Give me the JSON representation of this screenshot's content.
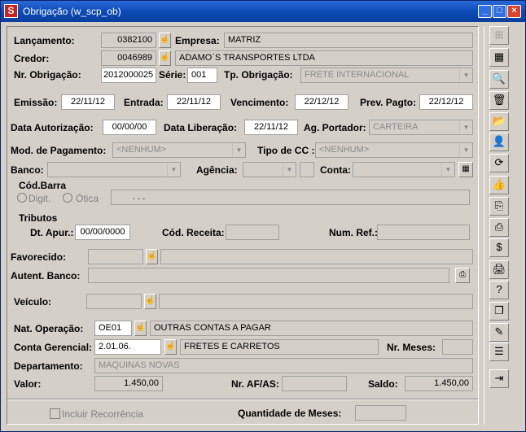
{
  "window": {
    "title": "Obrigação (w_scp_ob)",
    "app_icon": "S",
    "minimize": "_",
    "maximize": "□",
    "close": "×"
  },
  "lancamento": {
    "label": "Lançamento:",
    "value": "0382100"
  },
  "empresa": {
    "label": "Empresa:",
    "value": "MATRIZ"
  },
  "credor": {
    "label": "Credor:",
    "value": "0046989",
    "name": "ADAMO´S TRANSPORTES LTDA"
  },
  "nr_obrigacao": {
    "label": "Nr. Obrigação:",
    "value": "2012000025"
  },
  "serie": {
    "label": "Série:",
    "value": "001"
  },
  "tp_obrigacao": {
    "label": "Tp. Obrigação:",
    "value": "FRETE INTERNACIONAL"
  },
  "emissao": {
    "label": "Emissão:",
    "value": "22/11/12"
  },
  "entrada": {
    "label": "Entrada:",
    "value": "22/11/12"
  },
  "vencimento": {
    "label": "Vencimento:",
    "value": "22/12/12"
  },
  "prev_pagto": {
    "label": "Prev. Pagto:",
    "value": "22/12/12"
  },
  "data_autorizacao": {
    "label": "Data Autorização:",
    "value": "00/00/00"
  },
  "data_liberacao": {
    "label": "Data Liberação:",
    "value": "22/11/12"
  },
  "ag_portador": {
    "label": "Ag. Portador:",
    "value": "CARTEIRA"
  },
  "mod_pagamento": {
    "label": "Mod. de Pagamento:",
    "value": "<NENHUM>"
  },
  "tipo_cc": {
    "label": "Tipo de CC :",
    "value": "<NENHUM>"
  },
  "banco": {
    "label": "Banco:",
    "value": ""
  },
  "agencia": {
    "label": "Agência:",
    "value": ""
  },
  "conta": {
    "label": "Conta:",
    "value": ""
  },
  "cod_barra": {
    "label": "Cód.Barra",
    "digit": "Digit.",
    "otica": "Ótica",
    "value": ".            .            ."
  },
  "tributos": {
    "label": "Tributos",
    "dt_apur_label": "Dt. Apur.:",
    "dt_apur": "00/00/0000",
    "cod_receita_label": "Cód. Receita:",
    "cod_receita": "",
    "num_ref_label": "Num. Ref.:",
    "num_ref": ""
  },
  "favorecido": {
    "label": "Favorecido:",
    "code": "",
    "name": ""
  },
  "autent_banco": {
    "label": "Autent. Banco:",
    "value": ""
  },
  "veiculo": {
    "label": "Veículo:",
    "code": "",
    "name": ""
  },
  "nat_operacao": {
    "label": "Nat. Operação:",
    "code": "OE01",
    "name": "OUTRAS CONTAS A PAGAR"
  },
  "conta_gerencial": {
    "label": "Conta Gerencial:",
    "code": "2.01.06.",
    "name": "FRETES E CARRETOS"
  },
  "nr_meses": {
    "label": "Nr. Meses:",
    "value": ""
  },
  "departamento": {
    "label": "Departamento:",
    "value": "MAQUINAS NOVAS"
  },
  "valor": {
    "label": "Valor:",
    "value": "1.450,00"
  },
  "nr_af_as": {
    "label": "Nr. AF/AS:",
    "value": ""
  },
  "saldo": {
    "label": "Saldo:",
    "value": "1.450,00"
  },
  "incluir_recorrencia": {
    "label": "Incluir Recorrência"
  },
  "quantidade_meses": {
    "label": "Quantidade de Meses:",
    "value": ""
  },
  "lookup_glyph": "☝",
  "dropdown_glyph": "▼",
  "toolbar": [
    {
      "name": "tree-structure-icon",
      "glyph": "⊞",
      "enabled": false
    },
    {
      "name": "table-grid-icon",
      "glyph": "▦",
      "enabled": true
    },
    {
      "name": "print-preview-icon",
      "glyph": "🔍",
      "enabled": true
    },
    {
      "name": "trash-icon",
      "glyph": "🗑",
      "enabled": true
    },
    {
      "name": "folder-open-icon",
      "glyph": "📂",
      "enabled": false
    },
    {
      "name": "user-icon",
      "glyph": "👤",
      "enabled": true
    },
    {
      "name": "refresh-icon",
      "glyph": "⟳",
      "enabled": true
    },
    {
      "name": "thumbs-up-icon",
      "glyph": "👍",
      "enabled": true
    },
    {
      "name": "copy-document-icon",
      "glyph": "⎘",
      "enabled": true
    },
    {
      "name": "document-red-icon",
      "glyph": "⎙",
      "enabled": true
    },
    {
      "name": "money-bag-icon",
      "glyph": "$",
      "enabled": true
    },
    {
      "name": "printer-icon",
      "glyph": "🖨",
      "enabled": true
    },
    {
      "name": "document-question-icon",
      "glyph": "?",
      "enabled": true
    },
    {
      "name": "copy-pages-icon",
      "glyph": "❐",
      "enabled": true
    },
    {
      "name": "edit-checkbook-icon",
      "glyph": "✎",
      "enabled": true
    },
    {
      "name": "notes-icon",
      "glyph": "☰",
      "enabled": true
    },
    {
      "name": "exit-icon",
      "glyph": "⇥",
      "enabled": true
    }
  ]
}
